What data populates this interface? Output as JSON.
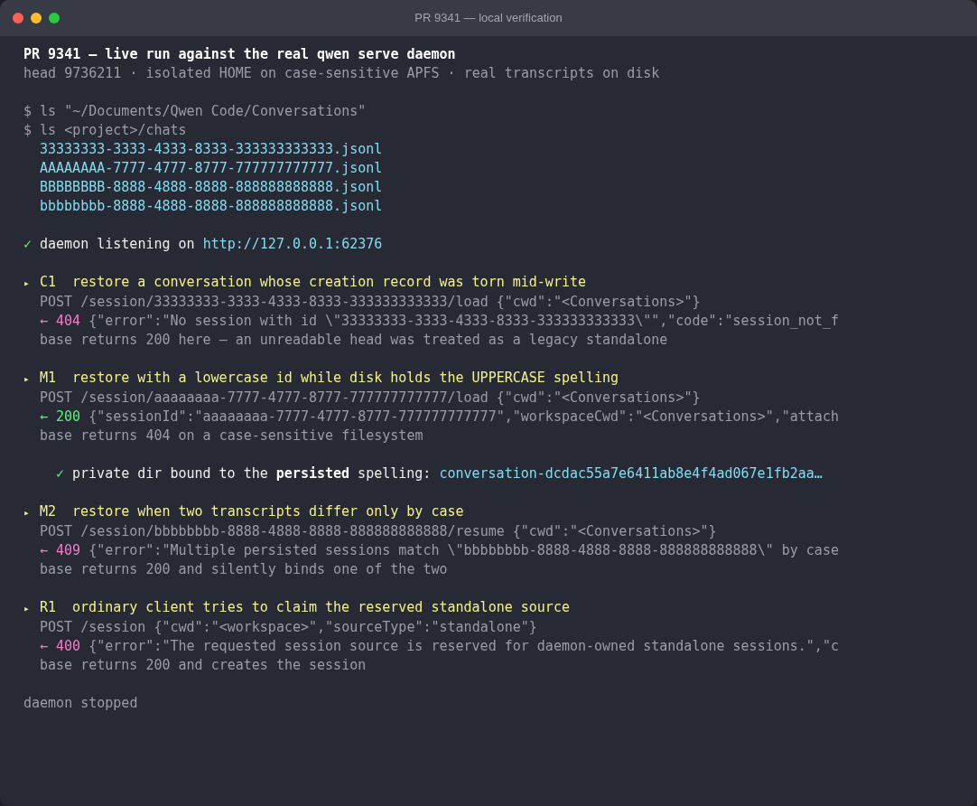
{
  "window": {
    "title": "PR 9341 — local verification"
  },
  "header": {
    "title": "PR 9341 — live run against the real qwen serve daemon",
    "subtitle": "head 9736211 · isolated HOME on case-sensitive APFS · real transcripts on disk"
  },
  "commands": [
    "$ ls \"~/Documents/Qwen Code/Conversations\"",
    "$ ls <project>/chats"
  ],
  "files": [
    "33333333-3333-4333-8333-333333333333.jsonl",
    "AAAAAAAA-7777-4777-8777-777777777777.jsonl",
    "BBBBBBBB-8888-4888-8888-888888888888.jsonl",
    "bbbbbbbb-8888-4888-8888-888888888888.jsonl"
  ],
  "status": {
    "mark": "✓",
    "text": "daemon listening on",
    "url": "http://127.0.0.1:62376"
  },
  "cases": [
    {
      "marker": "▸",
      "id": "C1",
      "title": "restore a conversation whose creation record was torn mid-write",
      "request": "POST /session/33333333-3333-4333-8333-333333333333/load {\"cwd\":\"<Conversations>\"}",
      "response": {
        "arrow": "←",
        "code": "404",
        "kind": "error",
        "body": "{\"error\":\"No session with id \\\"33333333-3333-4333-8333-333333333333\\\"\",\"code\":\"session_not_f"
      },
      "note": "base returns 200 here — an unreadable head was treated as a legacy standalone"
    },
    {
      "marker": "▸",
      "id": "M1",
      "title": "restore with a lowercase id while disk holds the UPPERCASE spelling",
      "request": "POST /session/aaaaaaaa-7777-4777-8777-777777777777/load {\"cwd\":\"<Conversations>\"}",
      "response": {
        "arrow": "←",
        "code": "200",
        "kind": "success",
        "body": "{\"sessionId\":\"aaaaaaaa-7777-4777-8777-777777777777\",\"workspaceCwd\":\"<Conversations>\",\"attach"
      },
      "note": "base returns 404 on a case-sensitive filesystem",
      "check": {
        "mark": "✓",
        "text": "private dir bound to the **persisted** spelling:",
        "value": "conversation-dcdac55a7e6411ab8e4f4ad067e1fb2aa…"
      }
    },
    {
      "marker": "▸",
      "id": "M2",
      "title": "restore when two transcripts differ only by case",
      "request": "POST /session/bbbbbbbb-8888-4888-8888-888888888888/resume {\"cwd\":\"<Conversations>\"}",
      "response": {
        "arrow": "←",
        "code": "409",
        "kind": "error",
        "body": "{\"error\":\"Multiple persisted sessions match \\\"bbbbbbbb-8888-4888-8888-888888888888\\\" by case"
      },
      "note": "base returns 200 and silently binds one of the two"
    },
    {
      "marker": "▸",
      "id": "R1",
      "title": "ordinary client tries to claim the reserved standalone source",
      "request": "POST /session {\"cwd\":\"<workspace>\",\"sourceType\":\"standalone\"}",
      "response": {
        "arrow": "←",
        "code": "400",
        "kind": "error",
        "body": "{\"error\":\"The requested session source is reserved for daemon-owned standalone sessions.\",\"c"
      },
      "note": "base returns 200 and creates the session"
    }
  ],
  "footer": "daemon stopped"
}
